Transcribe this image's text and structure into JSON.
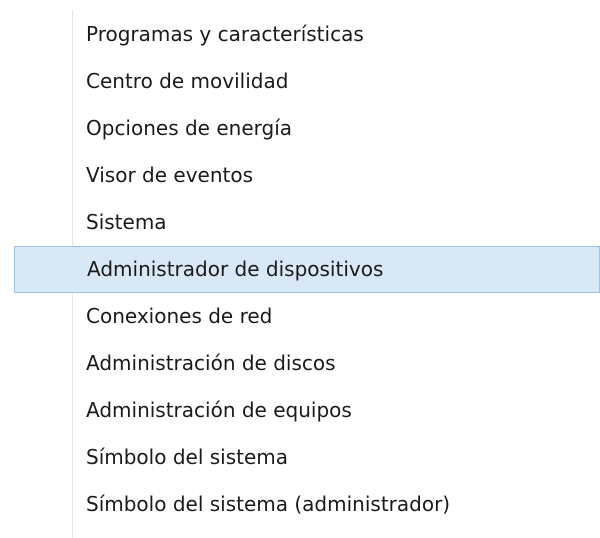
{
  "menu": {
    "items": [
      {
        "label": "Programas y características",
        "highlighted": false
      },
      {
        "label": "Centro de movilidad",
        "highlighted": false
      },
      {
        "label": "Opciones de energía",
        "highlighted": false
      },
      {
        "label": "Visor de eventos",
        "highlighted": false
      },
      {
        "label": "Sistema",
        "highlighted": false
      },
      {
        "label": "Administrador de dispositivos",
        "highlighted": true
      },
      {
        "label": "Conexiones de red",
        "highlighted": false
      },
      {
        "label": "Administración de discos",
        "highlighted": false
      },
      {
        "label": "Administración de equipos",
        "highlighted": false
      },
      {
        "label": "Símbolo del sistema",
        "highlighted": false
      },
      {
        "label": "Símbolo del sistema (administrador)",
        "highlighted": false
      }
    ],
    "colors": {
      "highlight_background": "#d9e8f6",
      "highlight_border": "#9fc3e3",
      "text": "#1a1a1a"
    }
  }
}
